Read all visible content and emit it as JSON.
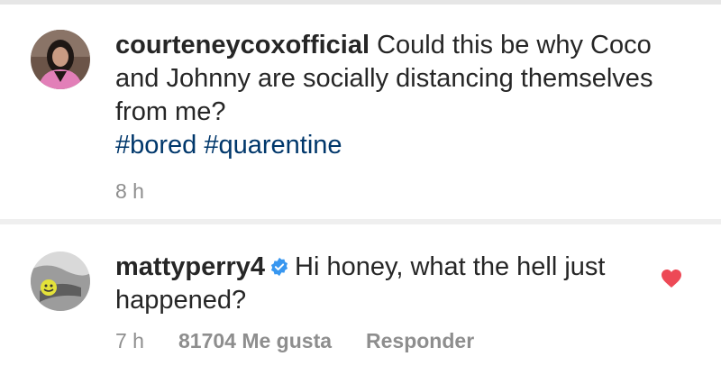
{
  "post": {
    "username": "courteneycoxofficial",
    "caption": "Could this be why Coco and Johnny are socially distancing themselves from me?",
    "hashtags": [
      "#bored",
      "#quarentine"
    ],
    "time": "8 h"
  },
  "comment": {
    "username": "mattyperry4",
    "text": "Hi honey, what the hell just happened?",
    "time": "7 h",
    "likes": "81704 Me gusta",
    "reply_label": "Responder",
    "heart_color": "#ed4956",
    "verified_color": "#3897f0"
  },
  "icons": {
    "verified": "verified-badge-icon",
    "like": "heart-icon"
  }
}
